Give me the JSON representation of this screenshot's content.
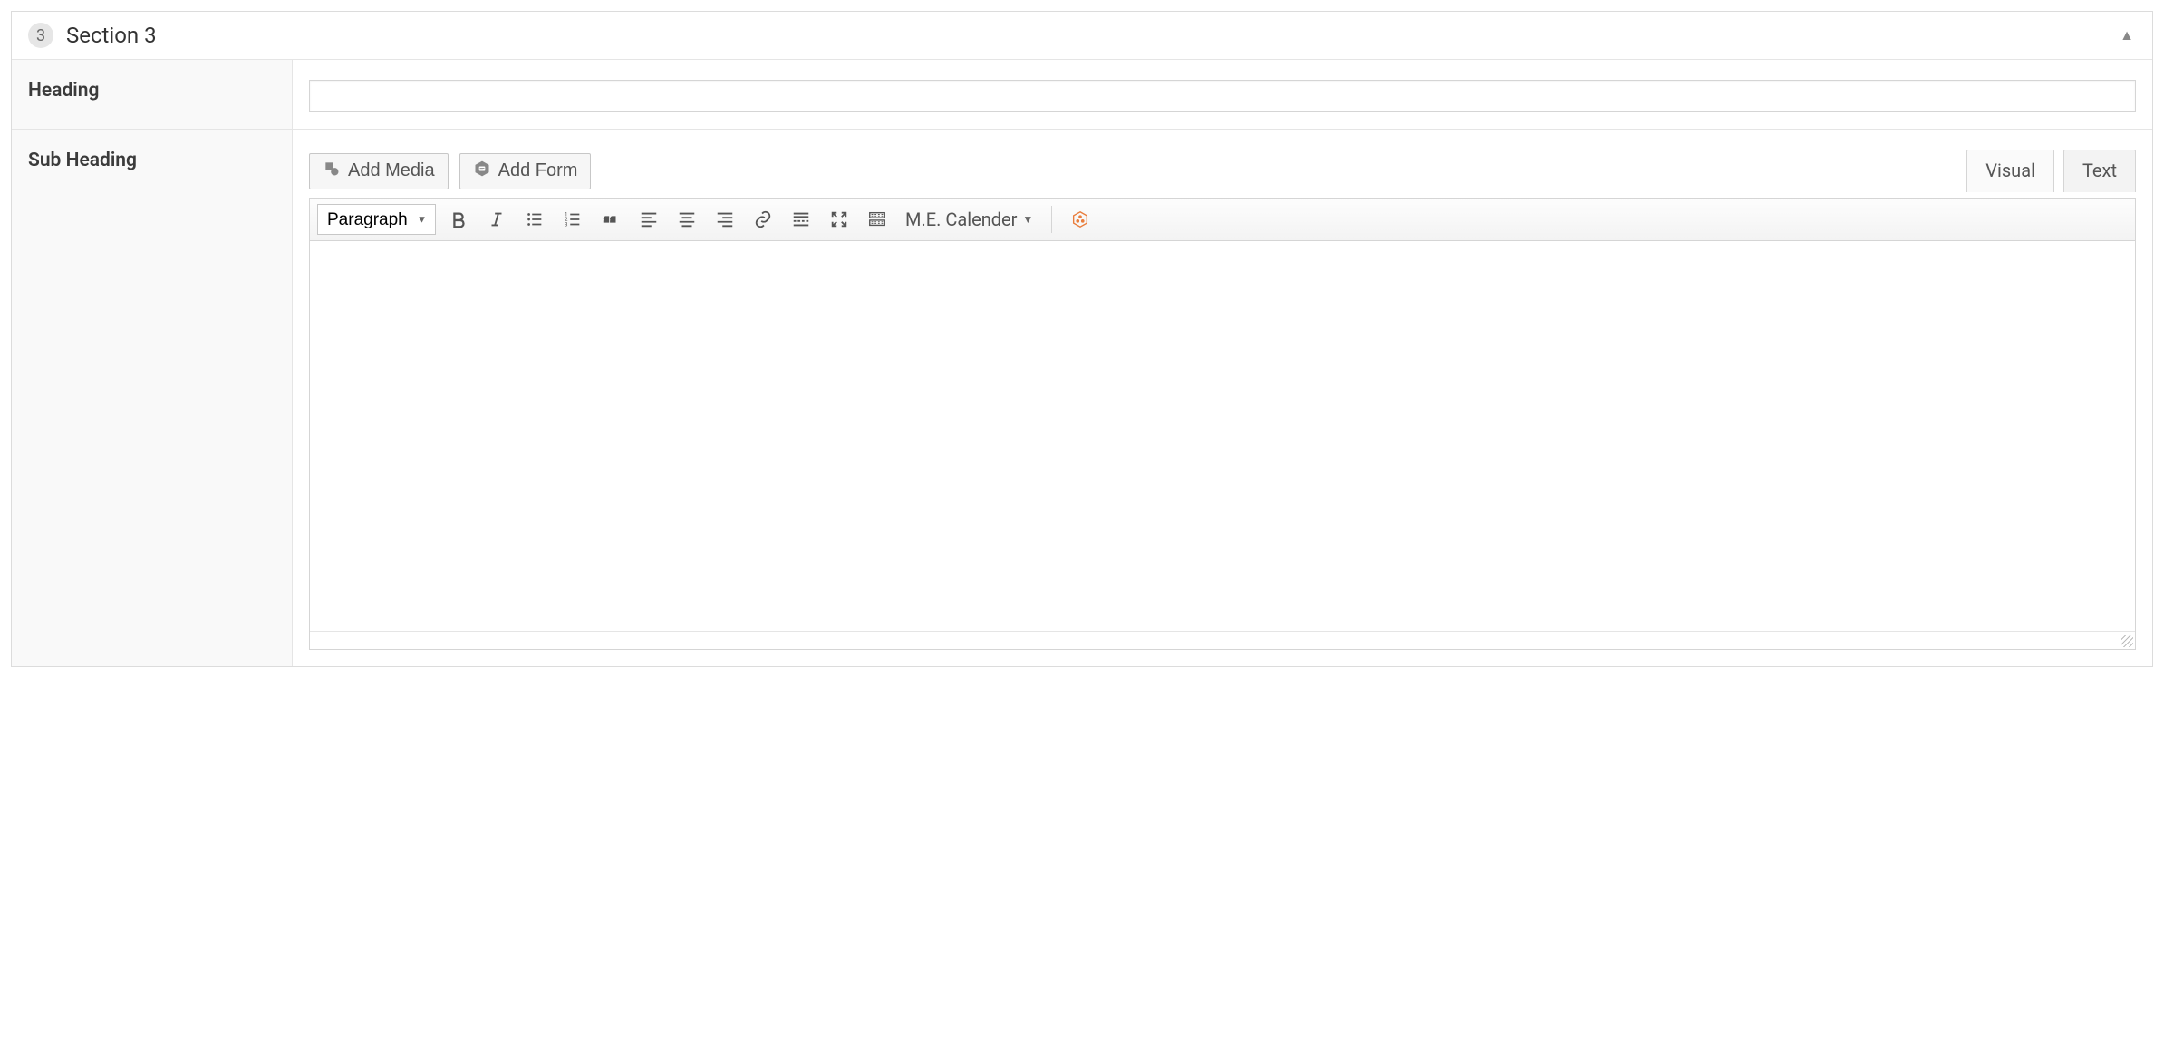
{
  "section": {
    "number": "3",
    "title": "Section 3"
  },
  "fields": {
    "heading_label": "Heading",
    "heading_value": "",
    "subheading_label": "Sub Heading"
  },
  "media_buttons": {
    "add_media": "Add Media",
    "add_form": "Add Form"
  },
  "editor_tabs": {
    "visual": "Visual",
    "text": "Text"
  },
  "toolbar": {
    "format_selected": "Paragraph",
    "me_calendar": "M.E. Calender"
  }
}
